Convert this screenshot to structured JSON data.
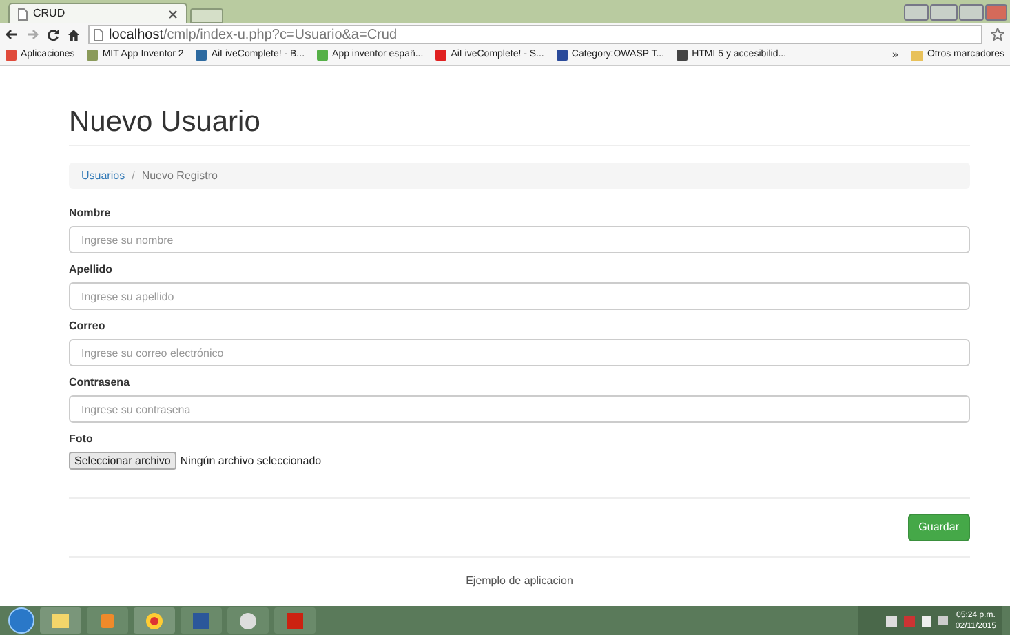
{
  "browser": {
    "tab_title": "CRUD",
    "url_host": "localhost",
    "url_path": "/cmlp/index-u.php?c=Usuario&a=Crud"
  },
  "bookmarks": [
    {
      "label": "Aplicaciones",
      "color": "#e04a3a"
    },
    {
      "label": "MIT App Inventor 2",
      "color": "#8a9a5a"
    },
    {
      "label": "AiLiveComplete! - B...",
      "color": "#2d6aa0"
    },
    {
      "label": "App inventor españ...",
      "color": "#55b047"
    },
    {
      "label": "AiLiveComplete! - S...",
      "color": "#e02020"
    },
    {
      "label": "Category:OWASP T...",
      "color": "#2a4a9a"
    },
    {
      "label": "HTML5 y accesibilid...",
      "color": "#444444"
    }
  ],
  "bookmarks_more": "»",
  "other_bookmarks": "Otros marcadores",
  "page": {
    "title": "Nuevo Usuario",
    "breadcrumb_separator": "/",
    "breadcrumb": [
      {
        "label": "Usuarios",
        "kind": "link"
      },
      {
        "label": "Nuevo Registro",
        "kind": "current"
      }
    ],
    "fields": [
      {
        "label": "Nombre",
        "placeholder": "Ingrese su nombre"
      },
      {
        "label": "Apellido",
        "placeholder": "Ingrese su apellido"
      },
      {
        "label": "Correo",
        "placeholder": "Ingrese su correo electrónico"
      },
      {
        "label": "Contrasena",
        "placeholder": "Ingrese su contrasena"
      }
    ],
    "file": {
      "label": "Foto",
      "button": "Seleccionar archivo",
      "status": "Ningún archivo seleccionado"
    },
    "submit": "Guardar",
    "footer": "Ejemplo de aplicacion"
  },
  "taskbar": {
    "time": "05:24 p.m.",
    "date": "02/11/2015"
  }
}
